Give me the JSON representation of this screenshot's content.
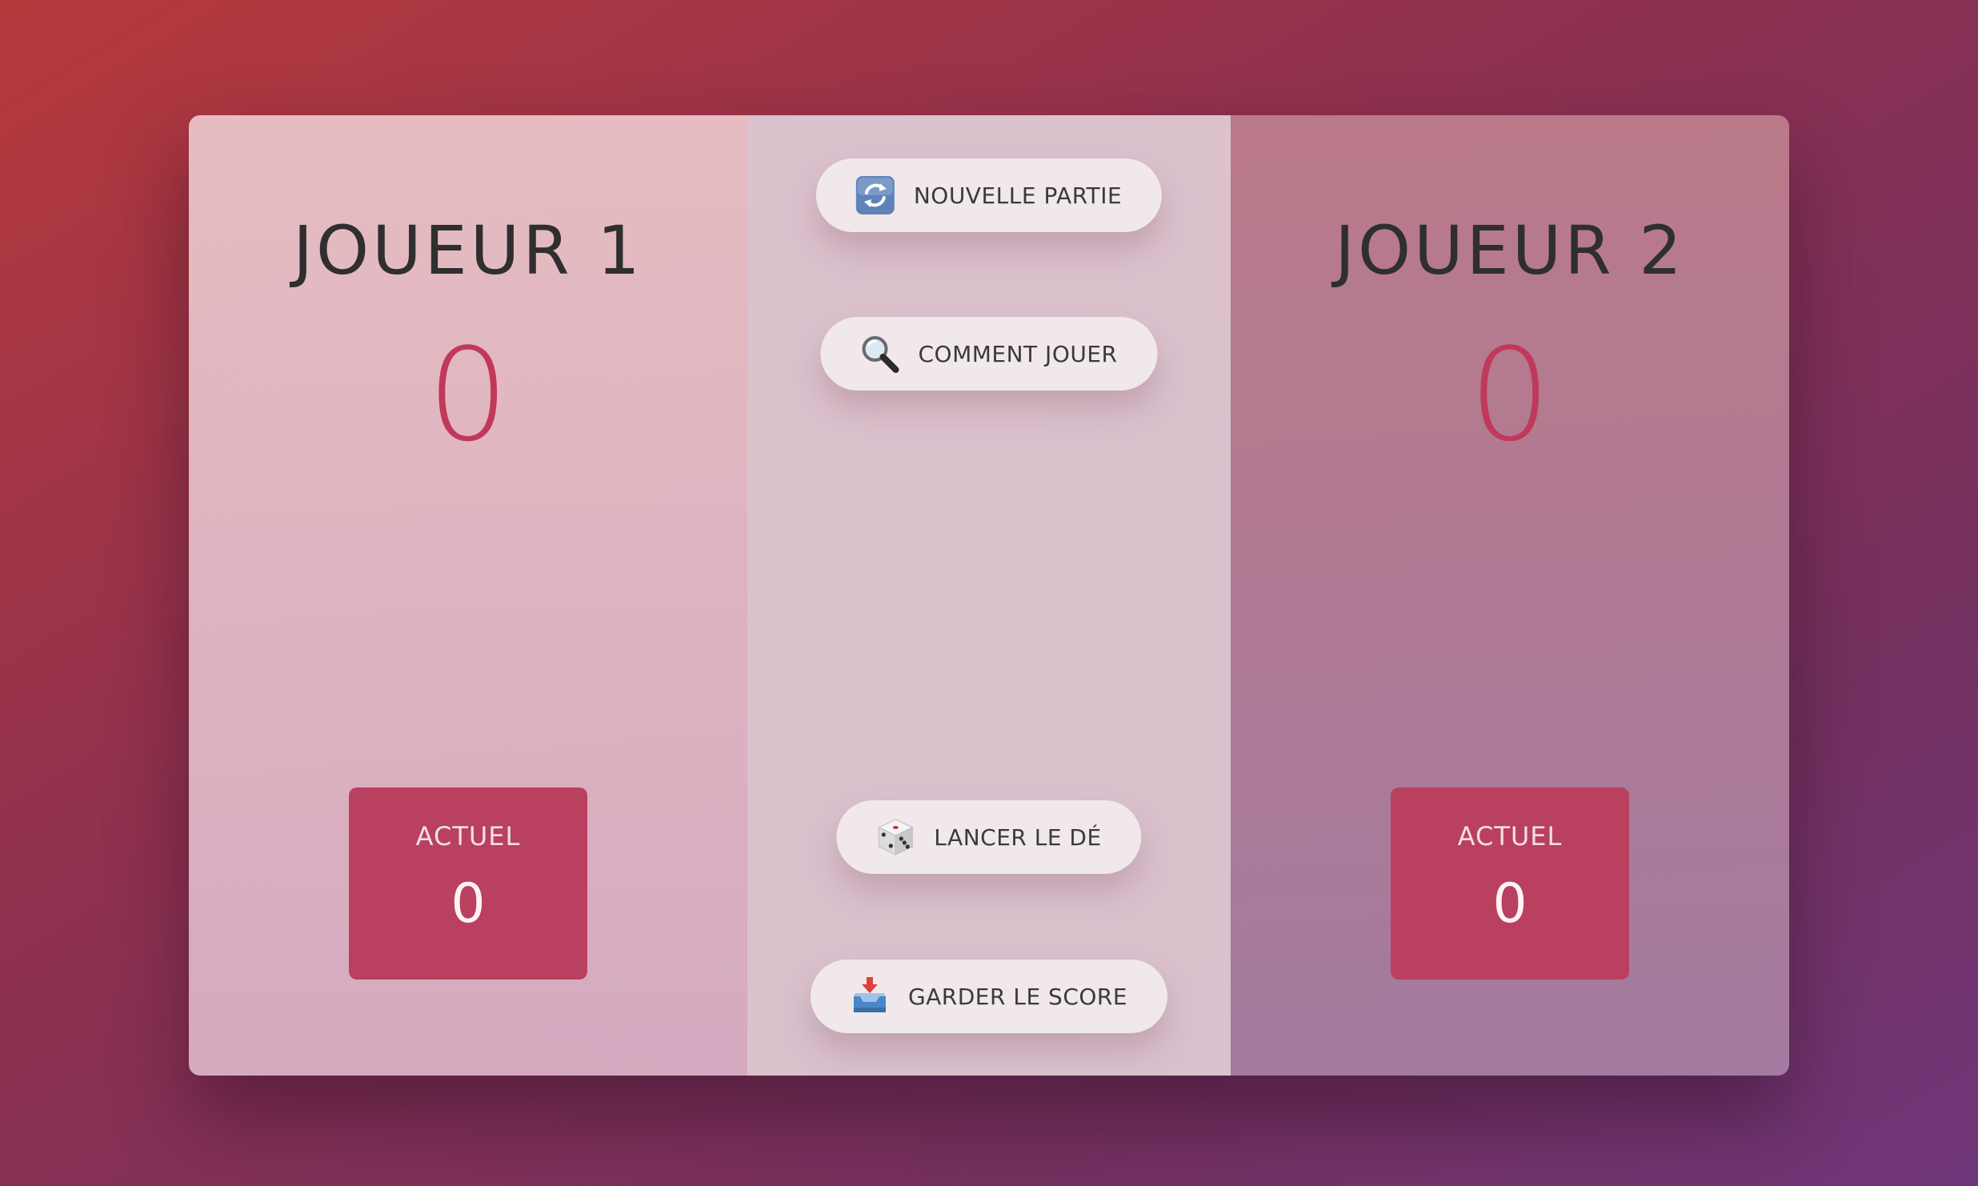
{
  "player1": {
    "name": "JOUEUR 1",
    "score": "0",
    "current_label": "ACTUEL",
    "current": "0"
  },
  "player2": {
    "name": "JOUEUR 2",
    "score": "0",
    "current_label": "ACTUEL",
    "current": "0"
  },
  "buttons": {
    "new_game": {
      "label": "NOUVELLE PARTIE",
      "icon": "refresh-icon"
    },
    "how_to_play": {
      "label": "COMMENT JOUER",
      "icon": "magnifier-icon"
    },
    "roll_dice": {
      "label": "LANCER LE DÉ",
      "icon": "dice-icon"
    },
    "hold": {
      "label": "GARDER LE SCORE",
      "icon": "inbox-tray-icon"
    }
  },
  "colors": {
    "accent": "#c0395a",
    "current_box": "#b9405f",
    "button_bg": "#f1e8eb"
  }
}
